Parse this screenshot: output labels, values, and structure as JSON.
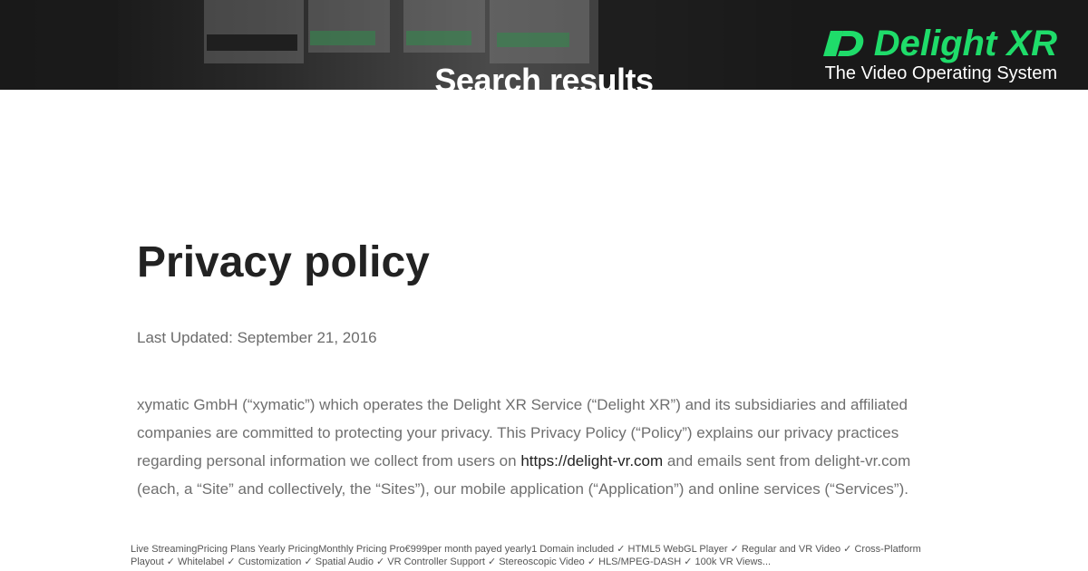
{
  "hero": {
    "title": "Search results"
  },
  "brand": {
    "logo_icon": "delight-xr-logo",
    "name": "Delight XR",
    "tagline": "The Video Operating System",
    "accent": "#1fdc6a"
  },
  "document": {
    "title": "Privacy policy",
    "last_updated": "Last Updated: September 21, 2016",
    "intro_before_link": "xymatic GmbH (“xymatic”) which operates the Delight XR Service (“Delight XR”) and its subsidiaries and affiliated companies are committed to protecting your privacy. This Privacy Policy (“Policy”) explains our privacy practices regarding personal information we collect from users on ",
    "intro_link": "https://delight-vr.com",
    "intro_after_link": " and emails sent from delight-vr.com (each, a “Site” and collectively, the “Sites”), our mobile application (“Application”) and online services (“Services”)."
  },
  "footer": {
    "description": "Live StreamingPricing Plans Yearly PricingMonthly Pricing Pro€999per month payed yearly1 Domain included ✓ HTML5 WebGL Player ✓ Regular and VR Video ✓ Cross-Platform Playout ✓ Whitelabel ✓ Customization ✓ Spatial Audio ✓ VR Controller Support ✓ Stereoscopic Video ✓ HLS/MPEG-DASH ✓ 100k VR Views..."
  }
}
